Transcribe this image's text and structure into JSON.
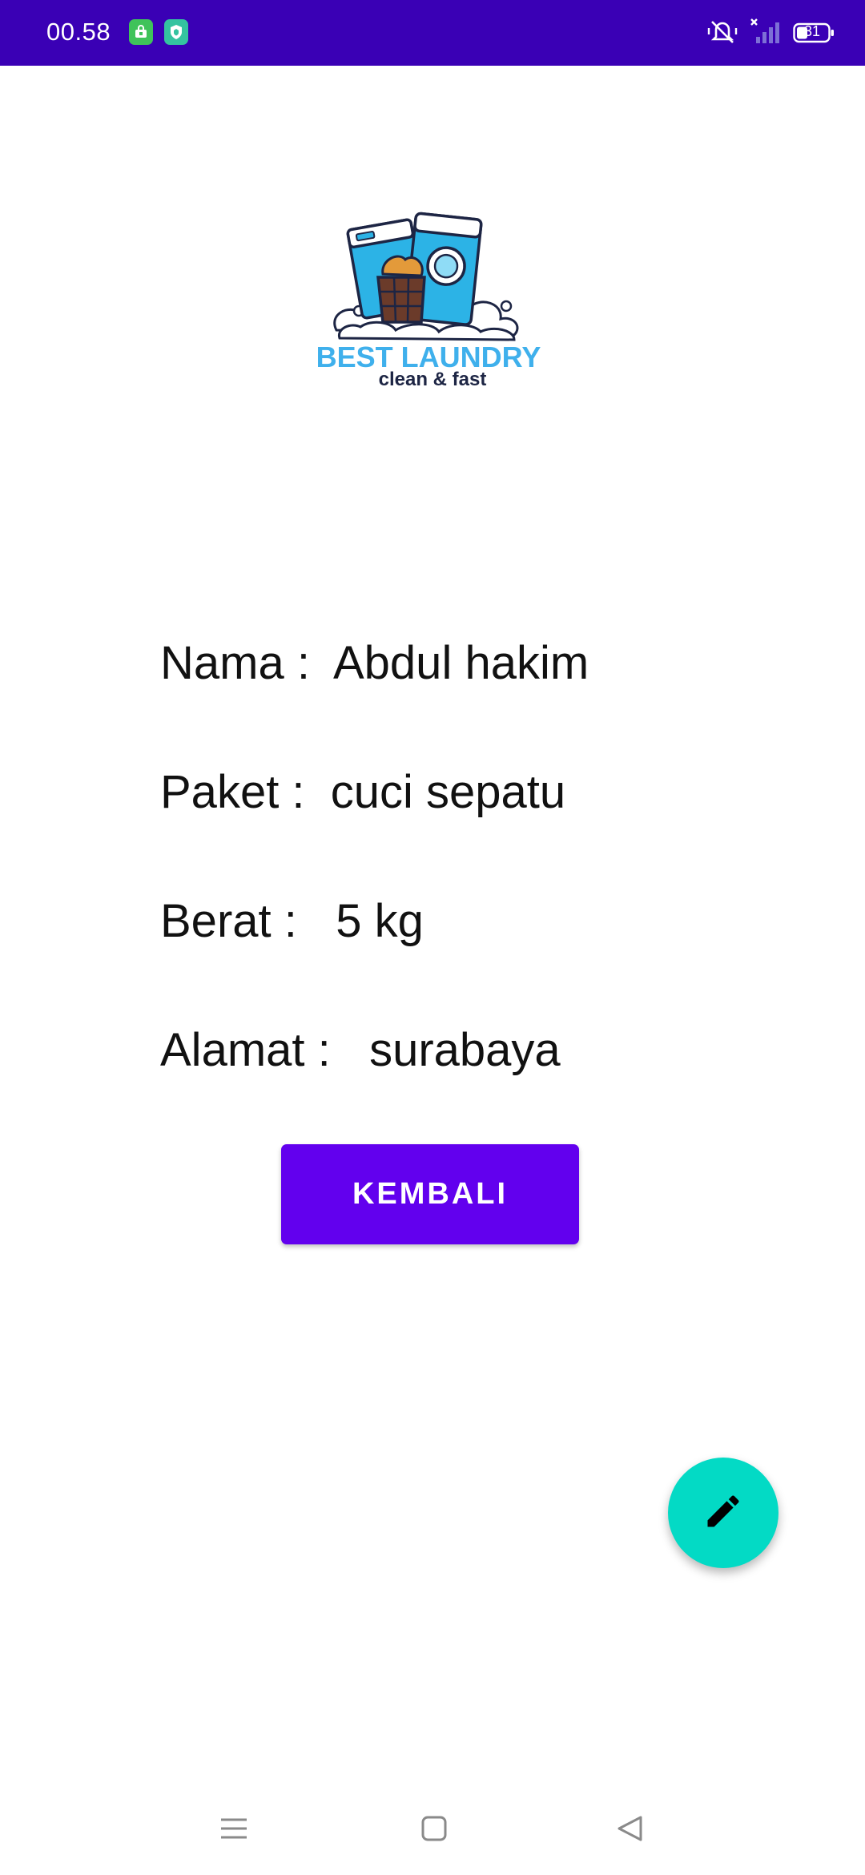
{
  "status_bar": {
    "time": "00.58",
    "battery_level": "31",
    "background_color": "#3a00b5",
    "icons": [
      "shop-app-icon",
      "shield-app-icon",
      "silent-vibrate-icon",
      "no-signal-icon",
      "battery-icon"
    ]
  },
  "logo": {
    "title": "BEST LAUNDRY",
    "tagline": "clean & fast"
  },
  "details": {
    "nama_label": "Nama :",
    "nama_value": "Abdul hakim",
    "paket_label": "Paket :",
    "paket_value": "cuci sepatu",
    "berat_label": "Berat :",
    "berat_value": "5 kg",
    "alamat_label": "Alamat :",
    "alamat_value": "surabaya"
  },
  "button": {
    "label": "KEMBALI",
    "color": "#6200ee"
  },
  "fab": {
    "icon": "edit-pencil-icon",
    "color": "#03dac5"
  },
  "nav_bar": {
    "icons": [
      "menu-icon",
      "home-square-icon",
      "back-triangle-icon"
    ]
  }
}
